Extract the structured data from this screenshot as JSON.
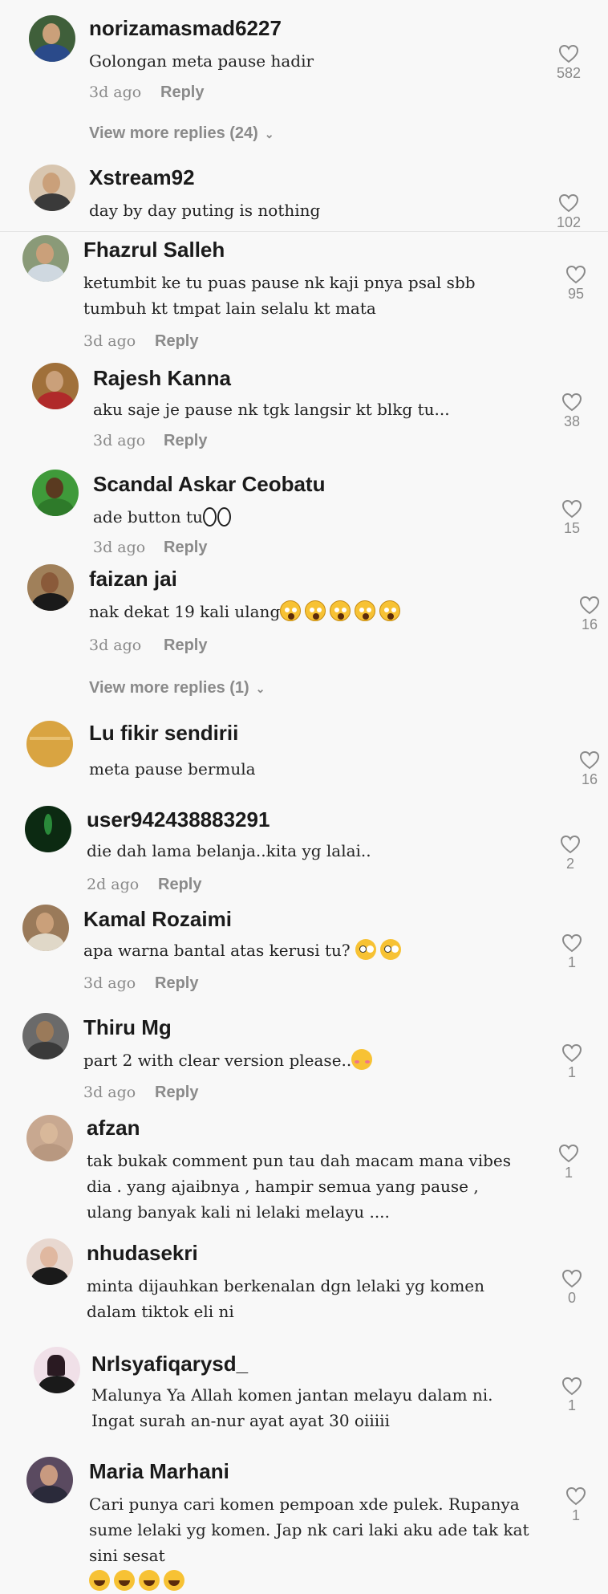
{
  "comments": [
    {
      "username": "norizamasmad6227",
      "text": "Golongan meta pause hadir",
      "time": "3d ago",
      "reply": "Reply",
      "likes": "582",
      "avatar_color": "#3f5f3a"
    },
    {
      "username": "Xstream92",
      "text": "day by day puting is nothing",
      "time": "",
      "reply": "",
      "likes": "102",
      "avatar_color": "#d8c6b0"
    },
    {
      "username": "Fhazrul Salleh",
      "text": "ketumbit ke tu puas pause nk kaji pnya psal sbb tumbuh kt tmpat lain selalu kt mata",
      "time": "3d ago",
      "reply": "Reply",
      "likes": "95",
      "avatar_color": "#8a9a78"
    },
    {
      "username": "Rajesh Kanna",
      "text": "aku saje je pause nk tgk langsir kt blkg tu...",
      "time": "3d ago",
      "reply": "Reply",
      "likes": "38",
      "avatar_color": "#a0703a"
    },
    {
      "username": "Scandal Askar Ceobatu",
      "text": "ade button tu",
      "time": "3d ago",
      "reply": "Reply",
      "likes": "15",
      "avatar_color": "#3f9a3a"
    },
    {
      "username": "faizan jai",
      "text": "nak dekat 19 kali ulang",
      "time": "3d ago",
      "reply": "Reply",
      "likes": "16",
      "avatar_color": "#a0805a"
    },
    {
      "username": "Lu fikir sendirii",
      "text": "meta pause bermula",
      "time": "",
      "reply": "",
      "likes": "16",
      "avatar_color": "#d9a441"
    },
    {
      "username": "user942438883291",
      "text": "die dah lama belanja..kita yg lalai..",
      "time": "2d ago",
      "reply": "Reply",
      "likes": "2",
      "avatar_color": "#0c2a12"
    },
    {
      "username": "Kamal Rozaimi",
      "text": "apa warna bantal atas kerusi tu?",
      "time": "3d ago",
      "reply": "Reply",
      "likes": "1",
      "avatar_color": "#9a7a5a"
    },
    {
      "username": "Thiru Mg",
      "text": "part 2 with clear version please..",
      "time": "3d ago",
      "reply": "Reply",
      "likes": "1",
      "avatar_color": "#6a6a6a"
    },
    {
      "username": "afzan",
      "text": "tak bukak comment pun tau dah macam mana vibes dia . yang ajaibnya , hampir semua yang pause , ulang banyak kali ni lelaki melayu ....",
      "time": "",
      "reply": "",
      "likes": "1",
      "avatar_color": "#c8a890"
    },
    {
      "username": "nhudasekri",
      "text": "minta dijauhkan berkenalan dgn lelaki yg komen dalam tiktok eli ni",
      "time": "",
      "reply": "",
      "likes": "0",
      "avatar_color": "#e8d8d0"
    },
    {
      "username": "Nrlsyafiqarysd_",
      "text": "Malunya Ya Allah komen jantan melayu dalam ni. Ingat surah an-nur ayat ayat 30 oiiiii",
      "time": "",
      "reply": "",
      "likes": "1",
      "avatar_color": "#f0e0e8"
    },
    {
      "username": "Maria Marhani",
      "text": "Cari punya cari komen pempoan xde pulek. Rupanya sume lelaki yg komen. Jap nk cari laki aku ade tak kat sini sesat",
      "time": "",
      "reply": "",
      "likes": "1",
      "avatar_color": "#5a4a60"
    }
  ],
  "view_more": [
    {
      "label": "View more replies (24)"
    },
    {
      "label": "View more replies (1)"
    }
  ]
}
